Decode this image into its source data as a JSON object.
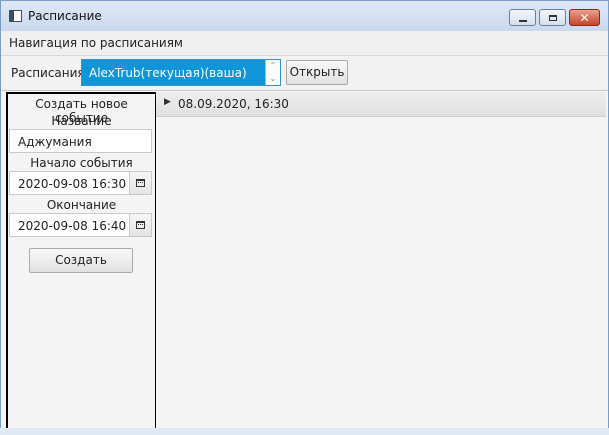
{
  "window": {
    "title": "Расписание"
  },
  "menu": {
    "navigation": "Навигация по расписаниям"
  },
  "toolbar": {
    "label": "Расписания",
    "selected_schedule": "AlexTrub(текущая)(ваша)",
    "open_button": "Открыть"
  },
  "form": {
    "header": "Создать новое событие",
    "name_label": "Название",
    "name_value": "Аджумания",
    "start_label": "Начало события",
    "start_value": "2020-09-08 16:30",
    "end_label": "Окончание",
    "end_value": "2020-09-08 16:40",
    "create_button": "Создать"
  },
  "events": [
    {
      "label": "08.09.2020, 16:30"
    }
  ],
  "colors": {
    "accent": "#0f95d8",
    "titlebar": "#c9d9ee",
    "panel_border": "#000000"
  },
  "icons": {
    "app": "window-icon",
    "calendar": "calendar-icon",
    "expand": "triangle-right-icon"
  }
}
